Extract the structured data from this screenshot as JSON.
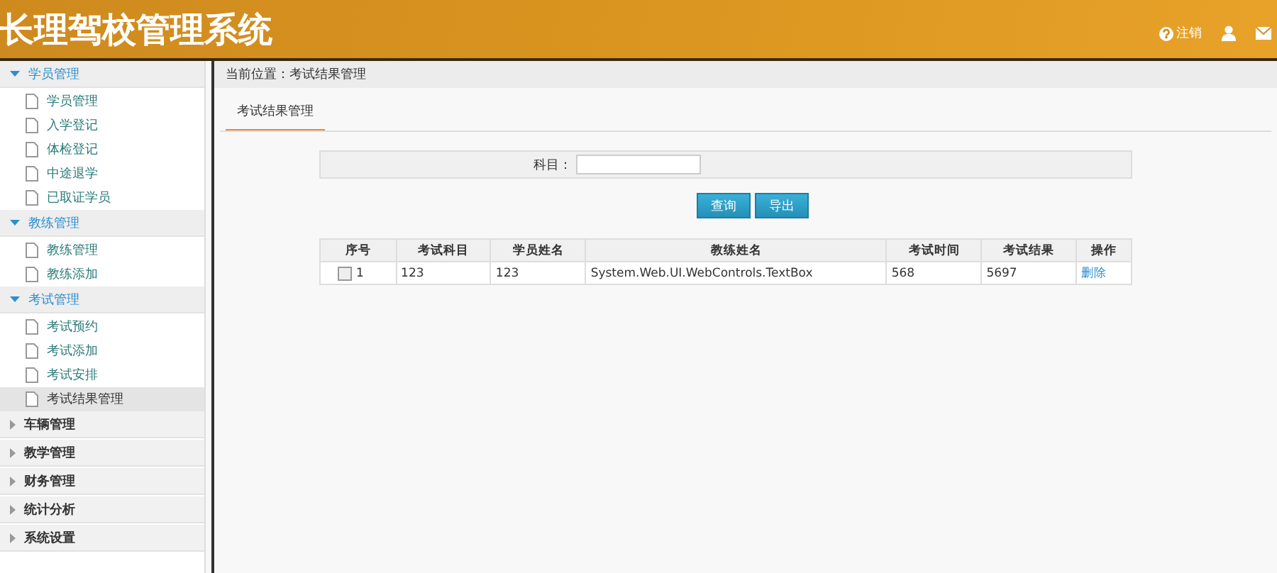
{
  "header": {
    "title": "长理驾校管理系统",
    "actions": [
      {
        "kind": "help",
        "label": "注销"
      },
      {
        "kind": "user"
      },
      {
        "kind": "mail"
      }
    ]
  },
  "sidebar": {
    "groups": [
      {
        "label": "学员管理",
        "expanded": true,
        "items": [
          {
            "label": "学员管理",
            "selected": false
          },
          {
            "label": "入学登记",
            "selected": false
          },
          {
            "label": "体检登记",
            "selected": false
          },
          {
            "label": "中途退学",
            "selected": false
          },
          {
            "label": "已取证学员",
            "selected": false
          }
        ]
      },
      {
        "label": "教练管理",
        "expanded": true,
        "items": [
          {
            "label": "教练管理",
            "selected": false
          },
          {
            "label": "教练添加",
            "selected": false
          }
        ]
      },
      {
        "label": "考试管理",
        "expanded": true,
        "items": [
          {
            "label": "考试预约",
            "selected": false
          },
          {
            "label": "考试添加",
            "selected": false
          },
          {
            "label": "考试安排",
            "selected": false
          },
          {
            "label": "考试结果管理",
            "selected": true
          }
        ]
      },
      {
        "label": "车辆管理",
        "expanded": false
      },
      {
        "label": "教学管理",
        "expanded": false
      },
      {
        "label": "财务管理",
        "expanded": false
      },
      {
        "label": "统计分析",
        "expanded": false
      },
      {
        "label": "系统设置",
        "expanded": false
      }
    ]
  },
  "breadcrumb": "当前位置：考试结果管理",
  "tabs": [
    {
      "label": "考试结果管理",
      "selected": true
    }
  ],
  "search": {
    "label": "科目：",
    "buttons": [
      "查询",
      "导出"
    ]
  },
  "table": {
    "columns": [
      {
        "kind": "text",
        "label": "序号"
      },
      {
        "kind": "text",
        "label": "考试科目"
      },
      {
        "kind": "text",
        "label": "学员姓名"
      },
      {
        "kind": "text",
        "label": "教练姓名"
      },
      {
        "kind": "text",
        "label": "考试时间"
      },
      {
        "kind": "text",
        "label": "考试结果"
      },
      {
        "kind": "text",
        "label": "操作"
      }
    ],
    "rows": [
      {
        "checked": false,
        "cells": [
          {
            "kind": "index",
            "text": "1"
          },
          {
            "kind": "text",
            "text": "123"
          },
          {
            "kind": "text",
            "text": "123"
          },
          {
            "kind": "wide",
            "text": "System.Web.UI.WebControls.TextBox"
          },
          {
            "kind": "text",
            "text": "568"
          },
          {
            "kind": "text",
            "text": "5697"
          },
          {
            "kind": "link",
            "text": "删除"
          }
        ]
      }
    ]
  }
}
